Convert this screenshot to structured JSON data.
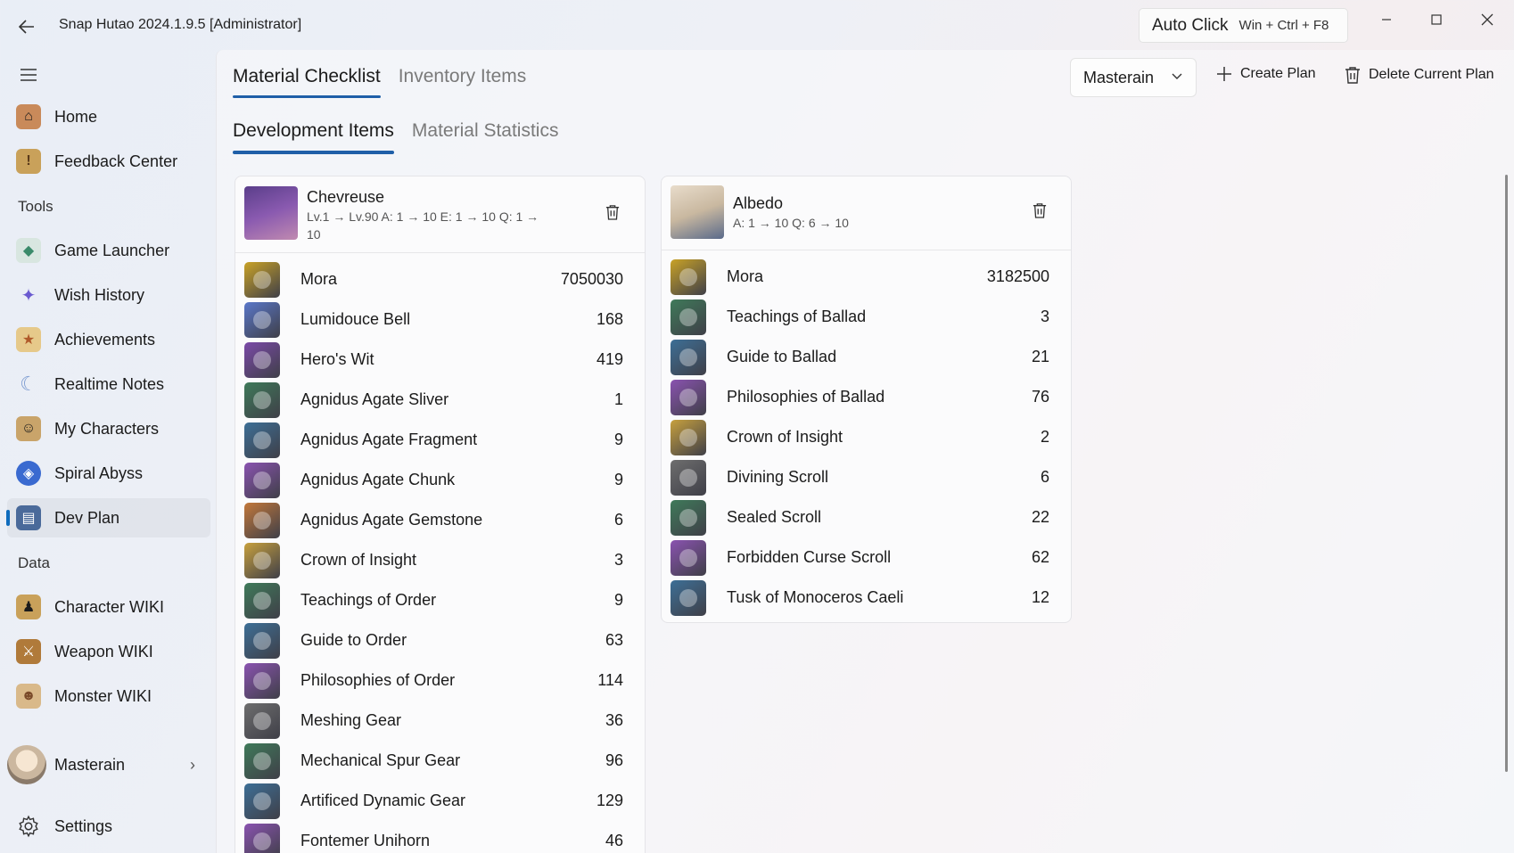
{
  "titlebar": {
    "title": "Snap Hutao 2024.1.9.5 [Administrator]",
    "auto_click_label": "Auto Click",
    "auto_click_shortcut": "Win + Ctrl + F8"
  },
  "sidebar": {
    "items_top": [
      {
        "label": "Home",
        "icon": "home-icon"
      },
      {
        "label": "Feedback Center",
        "icon": "feedback-icon"
      }
    ],
    "tools_header": "Tools",
    "tools": [
      {
        "label": "Game Launcher",
        "icon": "game-launcher-icon"
      },
      {
        "label": "Wish History",
        "icon": "wish-icon"
      },
      {
        "label": "Achievements",
        "icon": "achievement-icon"
      },
      {
        "label": "Realtime Notes",
        "icon": "moon-icon"
      },
      {
        "label": "My Characters",
        "icon": "characters-icon"
      },
      {
        "label": "Spiral Abyss",
        "icon": "abyss-icon"
      },
      {
        "label": "Dev Plan",
        "icon": "dev-plan-icon",
        "active": true
      }
    ],
    "data_header": "Data",
    "data": [
      {
        "label": "Character WIKI",
        "icon": "character-wiki-icon"
      },
      {
        "label": "Weapon WIKI",
        "icon": "weapon-wiki-icon"
      },
      {
        "label": "Monster WIKI",
        "icon": "monster-wiki-icon"
      }
    ],
    "user": "Masterain",
    "settings": "Settings"
  },
  "main": {
    "tabs": [
      {
        "label": "Material Checklist",
        "active": true
      },
      {
        "label": "Inventory Items",
        "active": false
      }
    ],
    "subtabs": [
      {
        "label": "Development Items",
        "active": true
      },
      {
        "label": "Material Statistics",
        "active": false
      }
    ],
    "plan_select": "Masterain",
    "create_plan": "Create Plan",
    "delete_plan": "Delete Current Plan"
  },
  "cards": [
    {
      "name": "Chevreuse",
      "levels_line1": "Lv.1 → Lv.90 A: 1 → 10 E: 1 → 10 Q: 1 →",
      "levels_line2": "10",
      "materials": [
        {
          "name": "Mora",
          "count": "7050030",
          "color": "#c9a227"
        },
        {
          "name": "Lumidouce Bell",
          "count": "168",
          "color": "#5a77c9"
        },
        {
          "name": "Hero's Wit",
          "count": "419",
          "color": "#7b4aa8"
        },
        {
          "name": "Agnidus Agate Sliver",
          "count": "1",
          "color": "#3f7a5a"
        },
        {
          "name": "Agnidus Agate Fragment",
          "count": "9",
          "color": "#3d6f96"
        },
        {
          "name": "Agnidus Agate Chunk",
          "count": "9",
          "color": "#8a53b0"
        },
        {
          "name": "Agnidus Agate Gemstone",
          "count": "6",
          "color": "#c2783b"
        },
        {
          "name": "Crown of Insight",
          "count": "3",
          "color": "#c7a03e"
        },
        {
          "name": "Teachings of Order",
          "count": "9",
          "color": "#3f7a5a"
        },
        {
          "name": "Guide to Order",
          "count": "63",
          "color": "#3d6f96"
        },
        {
          "name": "Philosophies of Order",
          "count": "114",
          "color": "#8a53b0"
        },
        {
          "name": "Meshing Gear",
          "count": "36",
          "color": "#6e6e6e"
        },
        {
          "name": "Mechanical Spur Gear",
          "count": "96",
          "color": "#3f7a5a"
        },
        {
          "name": "Artificed Dynamic Gear",
          "count": "129",
          "color": "#3d6f96"
        },
        {
          "name": "Fontemer Unihorn",
          "count": "46",
          "color": "#8a53b0"
        }
      ]
    },
    {
      "name": "Albedo",
      "levels_line1": "A: 1 → 10 Q: 6 → 10",
      "levels_line2": "",
      "materials": [
        {
          "name": "Mora",
          "count": "3182500",
          "color": "#c9a227"
        },
        {
          "name": "Teachings of Ballad",
          "count": "3",
          "color": "#3f7a5a"
        },
        {
          "name": "Guide to Ballad",
          "count": "21",
          "color": "#3d6f96"
        },
        {
          "name": "Philosophies of Ballad",
          "count": "76",
          "color": "#8a53b0"
        },
        {
          "name": "Crown of Insight",
          "count": "2",
          "color": "#c7a03e"
        },
        {
          "name": "Divining Scroll",
          "count": "6",
          "color": "#6e6e6e"
        },
        {
          "name": "Sealed Scroll",
          "count": "22",
          "color": "#3f7a5a"
        },
        {
          "name": "Forbidden Curse Scroll",
          "count": "62",
          "color": "#8a53b0"
        },
        {
          "name": "Tusk of Monoceros Caeli",
          "count": "12",
          "color": "#3d6f96"
        }
      ]
    }
  ]
}
